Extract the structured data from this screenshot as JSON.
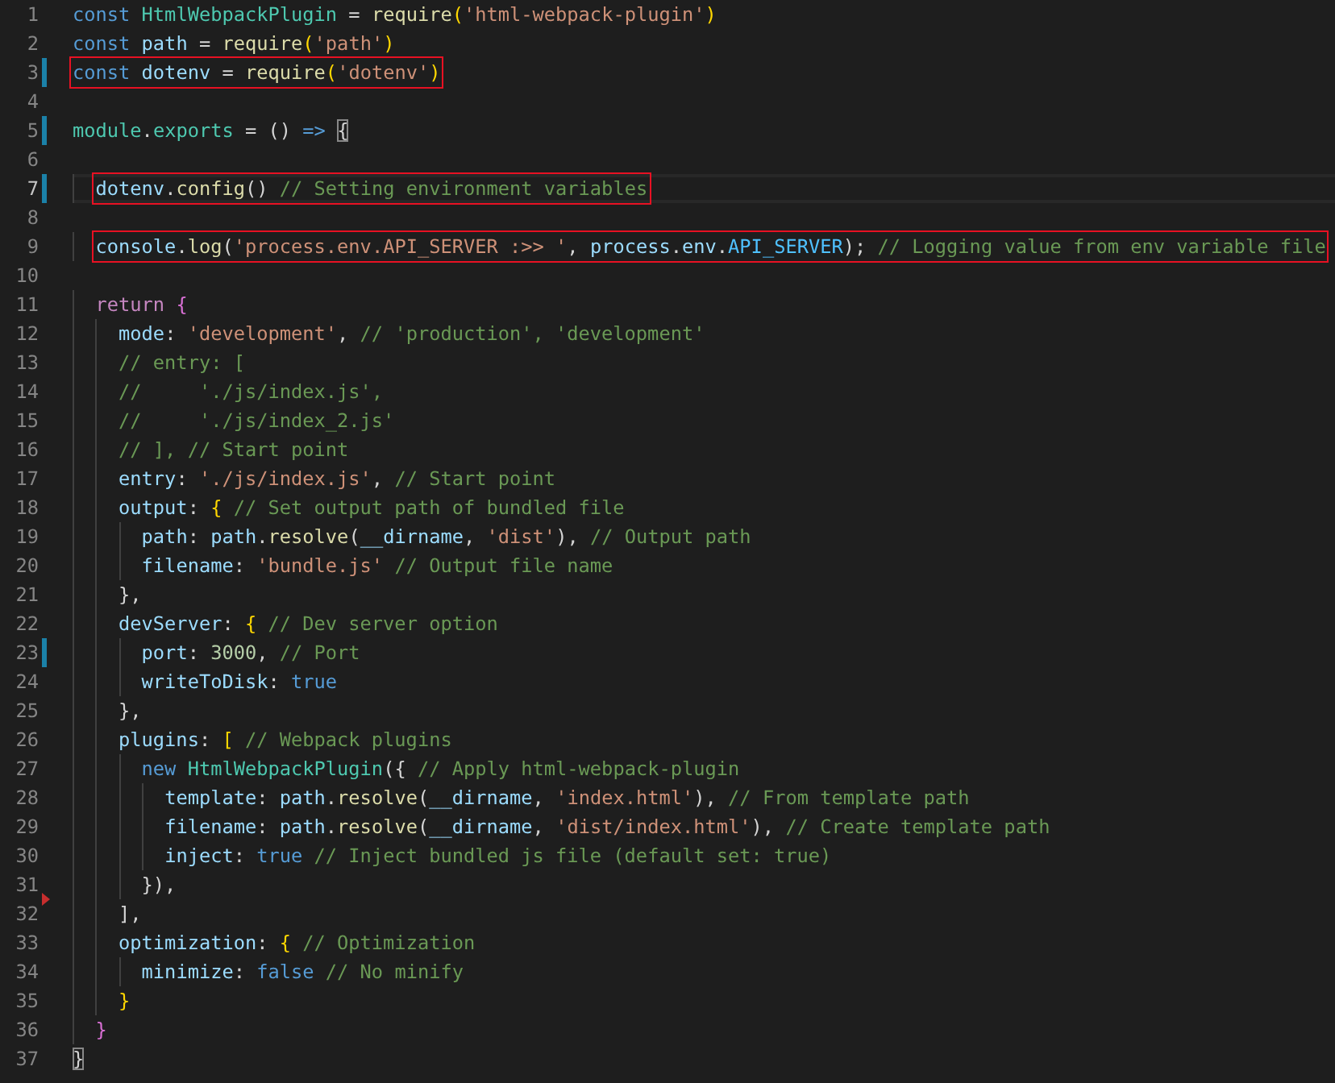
{
  "editor": {
    "lines": [
      {
        "number": "1",
        "modified": false,
        "boxed": false,
        "current": false,
        "marker": false,
        "tokens": [
          {
            "text": "const ",
            "kind": "kw"
          },
          {
            "text": "HtmlWebpackPlugin",
            "kind": "typ"
          },
          {
            "text": " = ",
            "kind": "pun"
          },
          {
            "text": "require",
            "kind": "fn"
          },
          {
            "text": "(",
            "kind": "br"
          },
          {
            "text": "'html-webpack-plugin'",
            "kind": "str"
          },
          {
            "text": ")",
            "kind": "br"
          }
        ]
      },
      {
        "number": "2",
        "modified": false,
        "boxed": false,
        "current": false,
        "marker": false,
        "tokens": [
          {
            "text": "const ",
            "kind": "kw"
          },
          {
            "text": "path",
            "kind": "var"
          },
          {
            "text": " = ",
            "kind": "pun"
          },
          {
            "text": "require",
            "kind": "fn"
          },
          {
            "text": "(",
            "kind": "br"
          },
          {
            "text": "'path'",
            "kind": "str"
          },
          {
            "text": ")",
            "kind": "br"
          }
        ]
      },
      {
        "number": "3",
        "modified": true,
        "boxed": true,
        "current": false,
        "marker": false,
        "tokens": [
          {
            "text": "const ",
            "kind": "kw"
          },
          {
            "text": "dotenv",
            "kind": "var"
          },
          {
            "text": " = ",
            "kind": "pun"
          },
          {
            "text": "require",
            "kind": "fn"
          },
          {
            "text": "(",
            "kind": "br"
          },
          {
            "text": "'dotenv'",
            "kind": "str"
          },
          {
            "text": ")",
            "kind": "br"
          }
        ]
      },
      {
        "number": "4",
        "modified": false,
        "boxed": false,
        "current": false,
        "marker": false
      },
      {
        "number": "5",
        "modified": true,
        "boxed": false,
        "current": false,
        "marker": false,
        "tokens": [
          {
            "text": "module",
            "kind": "typ"
          },
          {
            "text": ".",
            "kind": "pun"
          },
          {
            "text": "exports",
            "kind": "typ"
          },
          {
            "text": " = () ",
            "kind": "pun"
          },
          {
            "text": "=> ",
            "kind": "kw"
          },
          {
            "text": "{",
            "kind": "match"
          }
        ]
      },
      {
        "number": "6",
        "modified": false,
        "boxed": false,
        "current": false,
        "marker": false
      },
      {
        "number": "7",
        "modified": true,
        "boxed": true,
        "current": true,
        "marker": false,
        "tokens": [
          {
            "text": "  dotenv",
            "kind": "var"
          },
          {
            "text": ".",
            "kind": "pun"
          },
          {
            "text": "config",
            "kind": "fn"
          },
          {
            "text": "() ",
            "kind": "pun"
          },
          {
            "text": "// Setting environment variables",
            "kind": "cmt"
          }
        ]
      },
      {
        "number": "8",
        "modified": false,
        "boxed": false,
        "current": false,
        "marker": false
      },
      {
        "number": "9",
        "modified": false,
        "boxed": true,
        "current": false,
        "marker": false,
        "tokens": [
          {
            "text": "  console",
            "kind": "var"
          },
          {
            "text": ".",
            "kind": "pun"
          },
          {
            "text": "log",
            "kind": "fn"
          },
          {
            "text": "(",
            "kind": "pun"
          },
          {
            "text": "'process.env.API_SERVER :>> '",
            "kind": "str"
          },
          {
            "text": ", ",
            "kind": "pun"
          },
          {
            "text": "process",
            "kind": "var"
          },
          {
            "text": ".",
            "kind": "pun"
          },
          {
            "text": "env",
            "kind": "var"
          },
          {
            "text": ".",
            "kind": "pun"
          },
          {
            "text": "API_SERVER",
            "kind": "con"
          },
          {
            "text": "); ",
            "kind": "pun"
          },
          {
            "text": "// Logging value from env variable file",
            "kind": "cmt"
          }
        ]
      },
      {
        "number": "10",
        "modified": false,
        "boxed": false,
        "current": false,
        "marker": false
      },
      {
        "number": "11",
        "modified": false,
        "boxed": false,
        "current": false,
        "marker": false,
        "tokens": [
          {
            "text": "  return ",
            "kind": "ctl"
          },
          {
            "text": "{",
            "kind": "br2"
          }
        ]
      },
      {
        "number": "12",
        "modified": false,
        "boxed": false,
        "current": false,
        "marker": false,
        "tokens": [
          {
            "text": "    mode",
            "kind": "var"
          },
          {
            "text": ": ",
            "kind": "pun"
          },
          {
            "text": "'development'",
            "kind": "str"
          },
          {
            "text": ", ",
            "kind": "pun"
          },
          {
            "text": "// 'production', 'development'",
            "kind": "cmt"
          }
        ]
      },
      {
        "number": "13",
        "modified": false,
        "boxed": false,
        "current": false,
        "marker": false,
        "tokens": [
          {
            "text": "    // entry: [",
            "kind": "cmt"
          }
        ]
      },
      {
        "number": "14",
        "modified": false,
        "boxed": false,
        "current": false,
        "marker": false,
        "tokens": [
          {
            "text": "    //     './js/index.js',",
            "kind": "cmt"
          }
        ]
      },
      {
        "number": "15",
        "modified": false,
        "boxed": false,
        "current": false,
        "marker": false,
        "tokens": [
          {
            "text": "    //     './js/index_2.js'",
            "kind": "cmt"
          }
        ]
      },
      {
        "number": "16",
        "modified": false,
        "boxed": false,
        "current": false,
        "marker": false,
        "tokens": [
          {
            "text": "    // ], // Start point",
            "kind": "cmt"
          }
        ]
      },
      {
        "number": "17",
        "modified": false,
        "boxed": false,
        "current": false,
        "marker": false,
        "tokens": [
          {
            "text": "    entry",
            "kind": "var"
          },
          {
            "text": ": ",
            "kind": "pun"
          },
          {
            "text": "'./js/index.js'",
            "kind": "str"
          },
          {
            "text": ", ",
            "kind": "pun"
          },
          {
            "text": "// Start point",
            "kind": "cmt"
          }
        ]
      },
      {
        "number": "18",
        "modified": false,
        "boxed": false,
        "current": false,
        "marker": false,
        "tokens": [
          {
            "text": "    output",
            "kind": "var"
          },
          {
            "text": ": ",
            "kind": "pun"
          },
          {
            "text": "{ ",
            "kind": "br"
          },
          {
            "text": "// Set output path of bundled file",
            "kind": "cmt"
          }
        ]
      },
      {
        "number": "19",
        "modified": false,
        "boxed": false,
        "current": false,
        "marker": false,
        "tokens": [
          {
            "text": "      path",
            "kind": "var"
          },
          {
            "text": ": ",
            "kind": "pun"
          },
          {
            "text": "path",
            "kind": "var"
          },
          {
            "text": ".",
            "kind": "pun"
          },
          {
            "text": "resolve",
            "kind": "fn"
          },
          {
            "text": "(",
            "kind": "pun"
          },
          {
            "text": "__dirname",
            "kind": "var"
          },
          {
            "text": ", ",
            "kind": "pun"
          },
          {
            "text": "'dist'",
            "kind": "str"
          },
          {
            "text": "), ",
            "kind": "pun"
          },
          {
            "text": "// Output path",
            "kind": "cmt"
          }
        ]
      },
      {
        "number": "20",
        "modified": false,
        "boxed": false,
        "current": false,
        "marker": false,
        "tokens": [
          {
            "text": "      filename",
            "kind": "var"
          },
          {
            "text": ": ",
            "kind": "pun"
          },
          {
            "text": "'bundle.js' ",
            "kind": "str"
          },
          {
            "text": "// Output file name",
            "kind": "cmt"
          }
        ]
      },
      {
        "number": "21",
        "modified": false,
        "boxed": false,
        "current": false,
        "marker": false,
        "tokens": [
          {
            "text": "    },",
            "kind": "pun"
          }
        ]
      },
      {
        "number": "22",
        "modified": false,
        "boxed": false,
        "current": false,
        "marker": false,
        "tokens": [
          {
            "text": "    devServer",
            "kind": "var"
          },
          {
            "text": ": ",
            "kind": "pun"
          },
          {
            "text": "{ ",
            "kind": "br"
          },
          {
            "text": "// Dev server option",
            "kind": "cmt"
          }
        ]
      },
      {
        "number": "23",
        "modified": true,
        "boxed": false,
        "current": false,
        "marker": false,
        "tokens": [
          {
            "text": "      port",
            "kind": "var"
          },
          {
            "text": ": ",
            "kind": "pun"
          },
          {
            "text": "3000",
            "kind": "num"
          },
          {
            "text": ", ",
            "kind": "pun"
          },
          {
            "text": "// Port",
            "kind": "cmt"
          }
        ]
      },
      {
        "number": "24",
        "modified": false,
        "boxed": false,
        "current": false,
        "marker": false,
        "tokens": [
          {
            "text": "      writeToDisk",
            "kind": "var"
          },
          {
            "text": ": ",
            "kind": "pun"
          },
          {
            "text": "true",
            "kind": "kw"
          }
        ]
      },
      {
        "number": "25",
        "modified": false,
        "boxed": false,
        "current": false,
        "marker": false,
        "tokens": [
          {
            "text": "    },",
            "kind": "pun"
          }
        ]
      },
      {
        "number": "26",
        "modified": false,
        "boxed": false,
        "current": false,
        "marker": false,
        "tokens": [
          {
            "text": "    plugins",
            "kind": "var"
          },
          {
            "text": ": ",
            "kind": "pun"
          },
          {
            "text": "[ ",
            "kind": "br"
          },
          {
            "text": "// Webpack plugins",
            "kind": "cmt"
          }
        ]
      },
      {
        "number": "27",
        "modified": false,
        "boxed": false,
        "current": false,
        "marker": false,
        "tokens": [
          {
            "text": "      new ",
            "kind": "kw"
          },
          {
            "text": "HtmlWebpackPlugin",
            "kind": "typ"
          },
          {
            "text": "({ ",
            "kind": "pun"
          },
          {
            "text": "// Apply html-webpack-plugin",
            "kind": "cmt"
          }
        ]
      },
      {
        "number": "28",
        "modified": false,
        "boxed": false,
        "current": false,
        "marker": false,
        "tokens": [
          {
            "text": "        template",
            "kind": "var"
          },
          {
            "text": ": ",
            "kind": "pun"
          },
          {
            "text": "path",
            "kind": "var"
          },
          {
            "text": ".",
            "kind": "pun"
          },
          {
            "text": "resolve",
            "kind": "fn"
          },
          {
            "text": "(",
            "kind": "pun"
          },
          {
            "text": "__dirname",
            "kind": "var"
          },
          {
            "text": ", ",
            "kind": "pun"
          },
          {
            "text": "'index.html'",
            "kind": "str"
          },
          {
            "text": "), ",
            "kind": "pun"
          },
          {
            "text": "// From template path",
            "kind": "cmt"
          }
        ]
      },
      {
        "number": "29",
        "modified": false,
        "boxed": false,
        "current": false,
        "marker": false,
        "tokens": [
          {
            "text": "        filename",
            "kind": "var"
          },
          {
            "text": ": ",
            "kind": "pun"
          },
          {
            "text": "path",
            "kind": "var"
          },
          {
            "text": ".",
            "kind": "pun"
          },
          {
            "text": "resolve",
            "kind": "fn"
          },
          {
            "text": "(",
            "kind": "pun"
          },
          {
            "text": "__dirname",
            "kind": "var"
          },
          {
            "text": ", ",
            "kind": "pun"
          },
          {
            "text": "'dist/index.html'",
            "kind": "str"
          },
          {
            "text": "), ",
            "kind": "pun"
          },
          {
            "text": "// Create template path",
            "kind": "cmt"
          }
        ]
      },
      {
        "number": "30",
        "modified": false,
        "boxed": false,
        "current": false,
        "marker": false,
        "tokens": [
          {
            "text": "        inject",
            "kind": "var"
          },
          {
            "text": ": ",
            "kind": "pun"
          },
          {
            "text": "true ",
            "kind": "kw"
          },
          {
            "text": "// Inject bundled js file (default set: true)",
            "kind": "cmt"
          }
        ]
      },
      {
        "number": "31",
        "modified": false,
        "boxed": false,
        "current": false,
        "marker": true,
        "tokens": [
          {
            "text": "      }),",
            "kind": "pun"
          }
        ]
      },
      {
        "number": "32",
        "modified": false,
        "boxed": false,
        "current": false,
        "marker": false,
        "tokens": [
          {
            "text": "    ],",
            "kind": "pun"
          }
        ]
      },
      {
        "number": "33",
        "modified": false,
        "boxed": false,
        "current": false,
        "marker": false,
        "tokens": [
          {
            "text": "    optimization",
            "kind": "var"
          },
          {
            "text": ": ",
            "kind": "pun"
          },
          {
            "text": "{ ",
            "kind": "br"
          },
          {
            "text": "// Optimization",
            "kind": "cmt"
          }
        ]
      },
      {
        "number": "34",
        "modified": false,
        "boxed": false,
        "current": false,
        "marker": false,
        "tokens": [
          {
            "text": "      minimize",
            "kind": "var"
          },
          {
            "text": ": ",
            "kind": "pun"
          },
          {
            "text": "false ",
            "kind": "kw"
          },
          {
            "text": "// No minify",
            "kind": "cmt"
          }
        ]
      },
      {
        "number": "35",
        "modified": false,
        "boxed": false,
        "current": false,
        "marker": false,
        "tokens": [
          {
            "text": "    }",
            "kind": "br"
          }
        ]
      },
      {
        "number": "36",
        "modified": false,
        "boxed": false,
        "current": false,
        "marker": false,
        "tokens": [
          {
            "text": "  }",
            "kind": "br2"
          }
        ]
      },
      {
        "number": "37",
        "modified": false,
        "boxed": false,
        "current": false,
        "marker": false,
        "tokens": [
          {
            "text": "}",
            "kind": "match"
          }
        ]
      }
    ]
  }
}
